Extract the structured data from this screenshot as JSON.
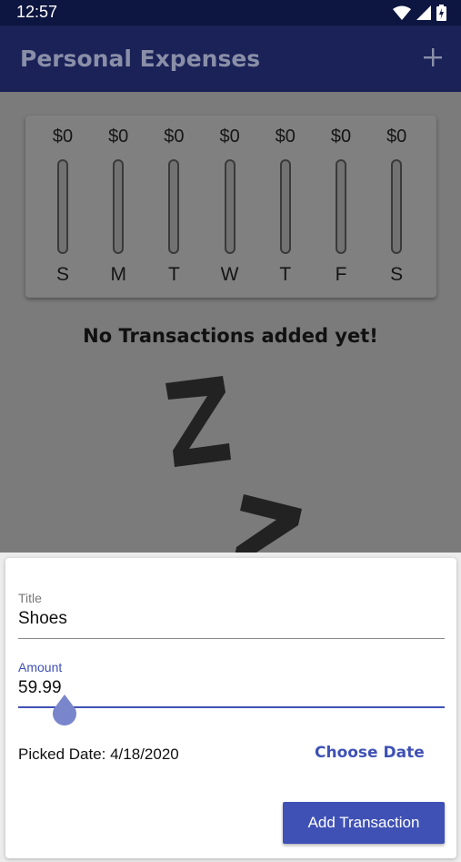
{
  "status_bar": {
    "time": "12:57"
  },
  "app_bar": {
    "title": "Personal Expenses",
    "add_icon": "plus-icon"
  },
  "chart": {
    "days": [
      {
        "label": "S",
        "amount": "$0",
        "fill": 0
      },
      {
        "label": "M",
        "amount": "$0",
        "fill": 0
      },
      {
        "label": "T",
        "amount": "$0",
        "fill": 0
      },
      {
        "label": "W",
        "amount": "$0",
        "fill": 0
      },
      {
        "label": "T",
        "amount": "$0",
        "fill": 0
      },
      {
        "label": "F",
        "amount": "$0",
        "fill": 0
      },
      {
        "label": "S",
        "amount": "$0",
        "fill": 0
      }
    ]
  },
  "empty_state": {
    "message": "No Transactions added yet!"
  },
  "form": {
    "title_label": "Title",
    "title_value": "Shoes",
    "amount_label": "Amount",
    "amount_value": "59.99",
    "picked_date": "Picked Date: 4/18/2020",
    "choose_date_label": "Choose Date",
    "submit_label": "Add Transaction"
  },
  "colors": {
    "app_bar": "#1a2258",
    "accent": "#3f51b5",
    "scrim": "#7b7b7b"
  }
}
